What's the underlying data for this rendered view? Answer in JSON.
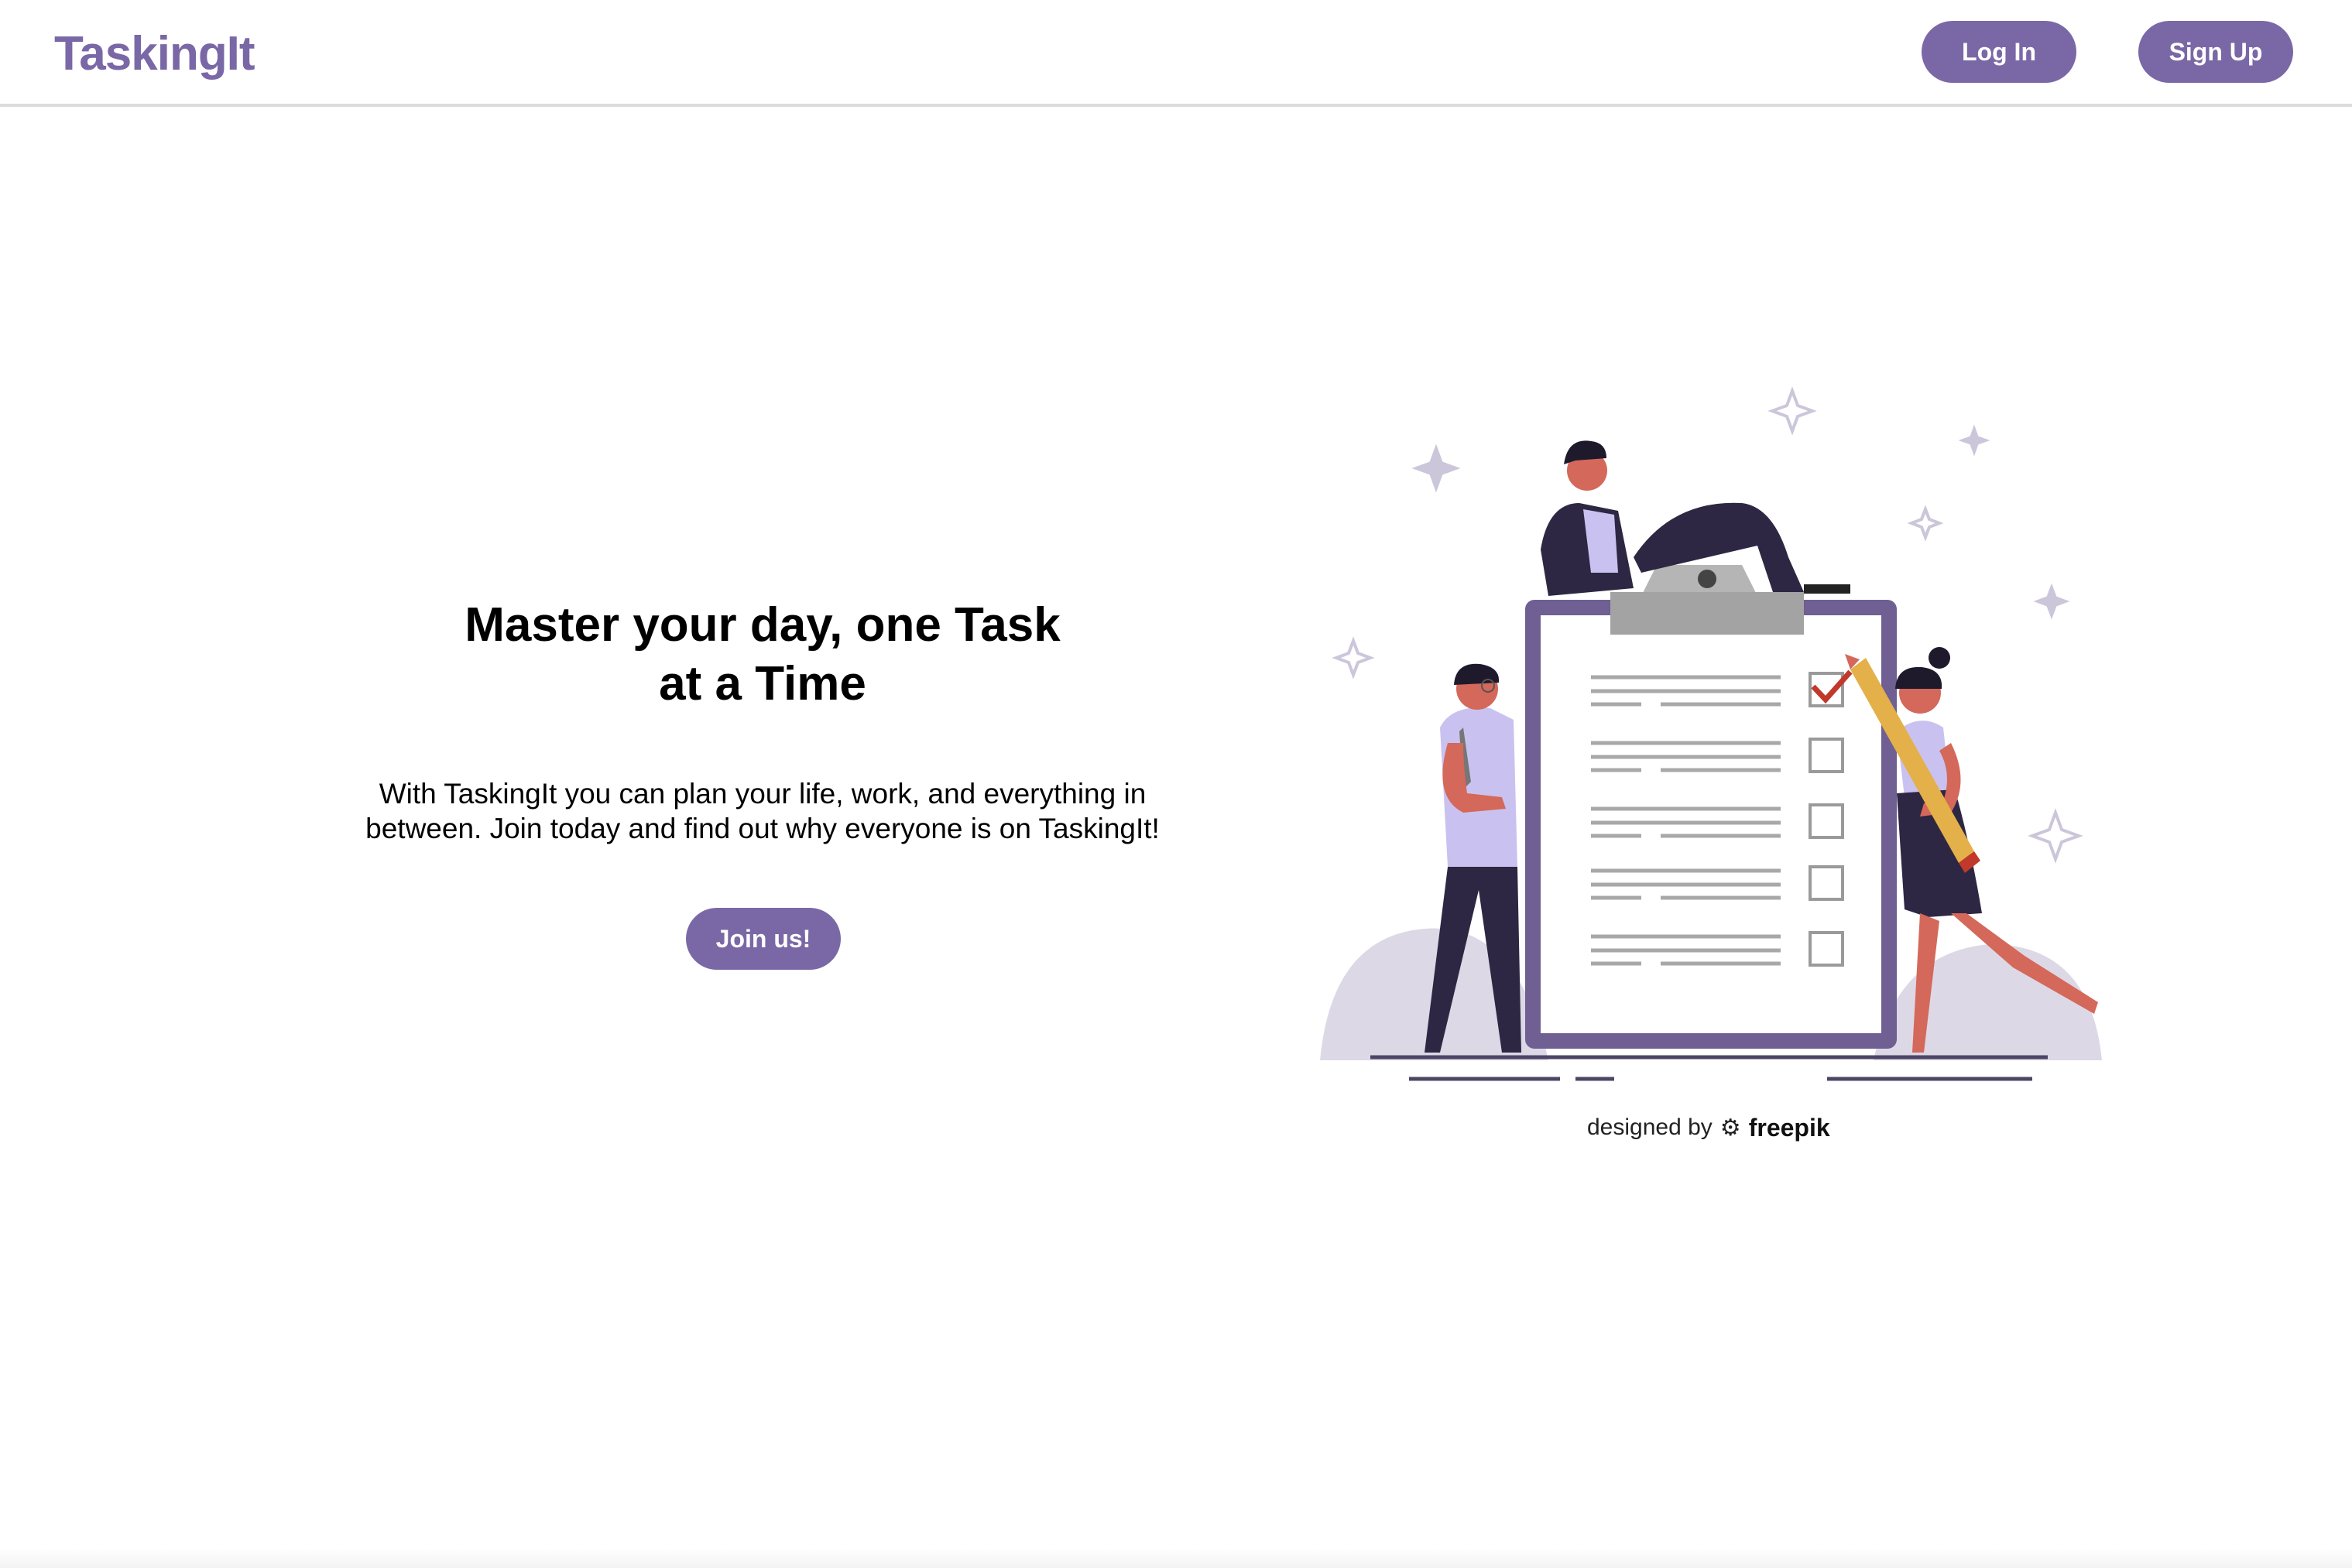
{
  "nav": {
    "brand": "TaskingIt",
    "login_label": "Log In",
    "signup_label": "Sign Up"
  },
  "hero": {
    "title_line1": "Master your day, one Task",
    "title_line2": "at a Time",
    "description_line1": "With TaskingIt you can plan your life, work, and everything in",
    "description_line2": "between. Join today and find out why everyone is on TaskingIt!",
    "cta_label": "Join us!"
  },
  "illustration": {
    "icon": "checklist-team-illustration",
    "checked_items": 1,
    "total_items": 5
  },
  "credit": {
    "prefix": "designed by",
    "brand": "freepik",
    "icon": "freepik-logo-icon"
  },
  "colors": {
    "accent": "#7a68a6",
    "clipboard": "#6f5f93",
    "blob": "#ddd8e6",
    "dark": "#2e2743",
    "skin": "#d4685a",
    "pencil": "#e4b04a",
    "check": "#c0392b"
  }
}
